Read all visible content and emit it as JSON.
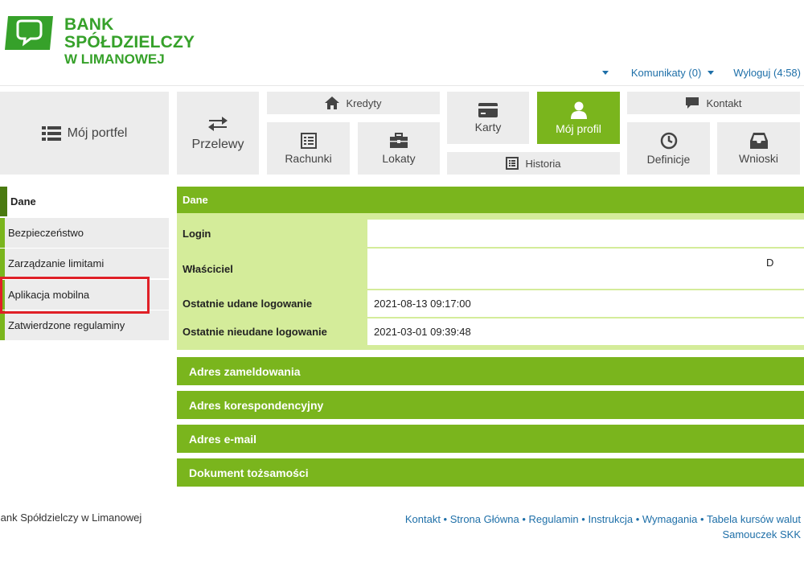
{
  "brand": {
    "line1": "BANK SPÓŁDZIELCZY",
    "line2": "W LIMANOWEJ",
    "color": "#36a12a"
  },
  "topbar": {
    "messages": "Komunikaty (0)",
    "logout": "Wyloguj (4:58)"
  },
  "nav": {
    "portfel": "Mój portfel",
    "przelewy": "Przelewy",
    "kredyty": "Kredyty",
    "rachunki": "Rachunki",
    "lokaty": "Lokaty",
    "karty": "Karty",
    "profil": "Mój profil",
    "historia": "Historia",
    "kontakt": "Kontakt",
    "definicje": "Definicje",
    "wnioski": "Wnioski"
  },
  "sidebar": {
    "items": [
      {
        "label": "Dane"
      },
      {
        "label": "Bezpieczeństwo"
      },
      {
        "label": "Zarządzanie limitami"
      },
      {
        "label": "Aplikacja mobilna"
      },
      {
        "label": "Zatwierdzone regulaminy"
      }
    ]
  },
  "panel": {
    "title": "Dane",
    "rows": [
      {
        "label": "Login",
        "value": ""
      },
      {
        "label": "Właściciel",
        "value": "D"
      },
      {
        "label": "Ostatnie udane logowanie",
        "value": "2021-08-13 09:17:00"
      },
      {
        "label": "Ostatnie nieudane logowanie",
        "value": "2021-03-01 09:39:48"
      }
    ]
  },
  "sections": {
    "adres_zameldowania": "Adres zameldowania",
    "adres_korespondencyjny": "Adres korespondencyjny",
    "adres_email": "Adres e-mail",
    "dokument": "Dokument tożsamości"
  },
  "footer": {
    "copyright": "Bank Spółdzielczy w Limanowej",
    "links": {
      "kontakt": "Kontakt",
      "strona": "Strona Główna",
      "regulamin": "Regulamin",
      "instrukcja": "Instrukcja",
      "wymagania": "Wymagania",
      "tabela": "Tabela kursów walut",
      "samouczek": "Samouczek SKK"
    }
  },
  "colors": {
    "green": "#7ab51d",
    "light_green": "#d4ec9a",
    "tile_grey": "#ececec",
    "link_blue": "#1e6fa8",
    "highlight_red": "#e02027"
  }
}
